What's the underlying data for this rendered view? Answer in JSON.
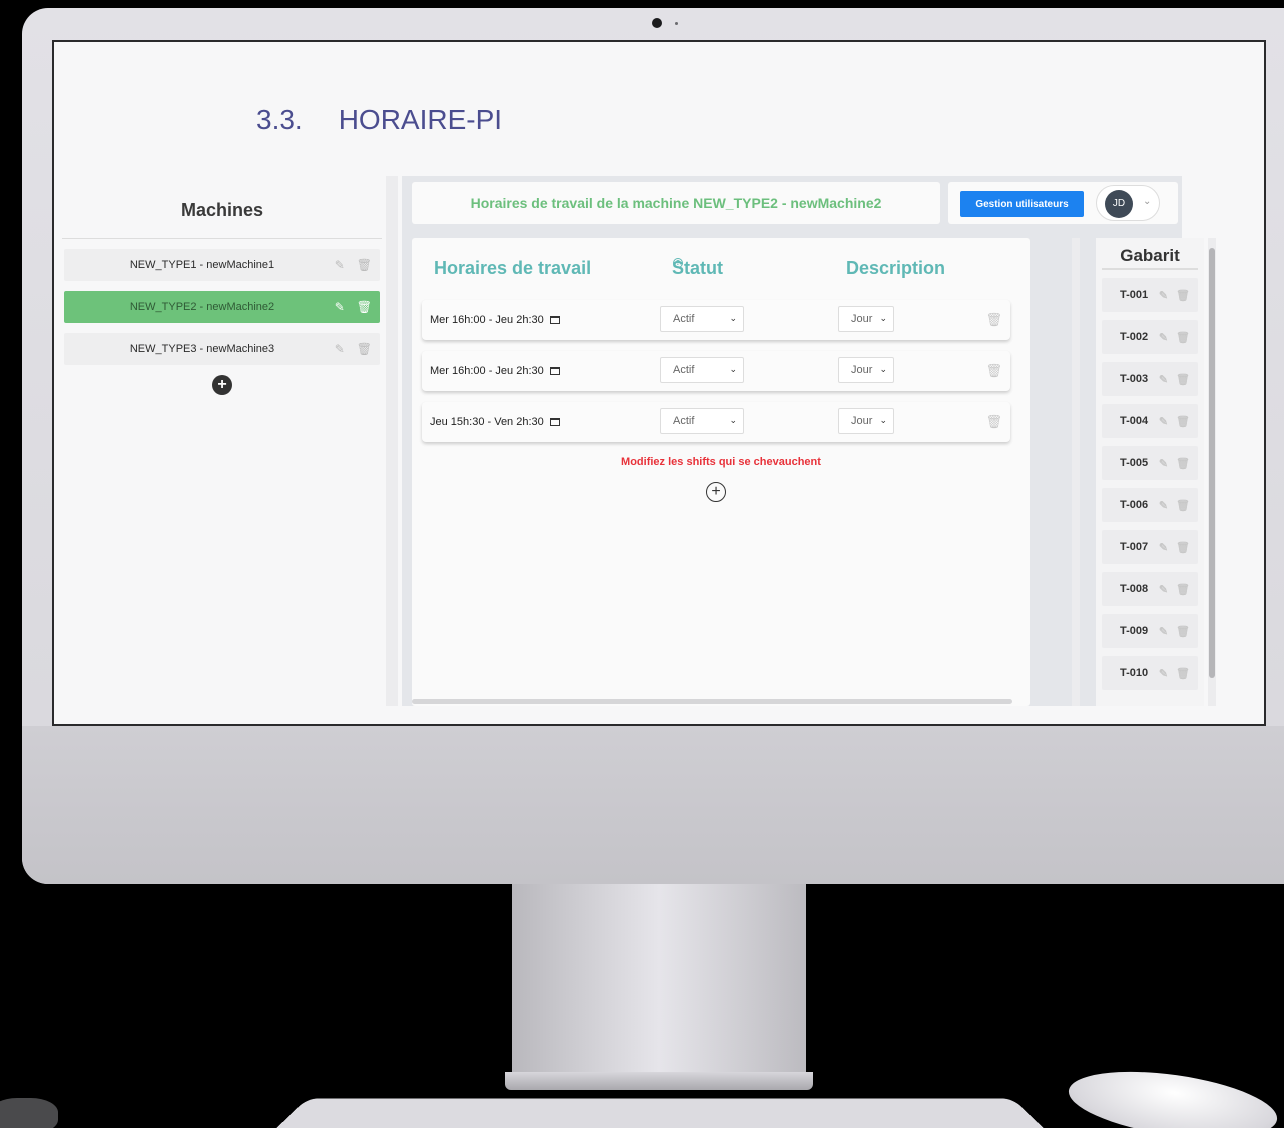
{
  "doc_heading": {
    "number": "3.3.",
    "title": "HORAIRE-PI"
  },
  "machines": {
    "title": "Machines",
    "items": [
      {
        "label": "NEW_TYPE1 - newMachine1",
        "active": false
      },
      {
        "label": "NEW_TYPE2 - newMachine2",
        "active": true
      },
      {
        "label": "NEW_TYPE3 - newMachine3",
        "active": false
      }
    ],
    "add_glyph": "+"
  },
  "header": {
    "title": "Horaires de travail de la machine NEW_TYPE2 - newMachine2",
    "users_button": "Gestion utilisateurs",
    "avatar_initials": "JD"
  },
  "schedule": {
    "columns": {
      "hours": "Horaires de travail",
      "status": "Statut",
      "status_help": "?",
      "description": "Description"
    },
    "rows": [
      {
        "time": "Mer 16h:00 - Jeu 2h:30",
        "status": "Actif",
        "description": "Jour"
      },
      {
        "time": "Mer 16h:00 - Jeu 2h:30",
        "status": "Actif",
        "description": "Jour"
      },
      {
        "time": "Jeu 15h:30 - Ven 2h:30",
        "status": "Actif",
        "description": "Jour"
      }
    ],
    "warning": "Modifiez les shifts qui se chevauchent",
    "add_glyph": "+"
  },
  "gabarit": {
    "title": "Gabarit",
    "items": [
      "T-001",
      "T-002",
      "T-003",
      "T-004",
      "T-005",
      "T-006",
      "T-007",
      "T-008",
      "T-009",
      "T-010"
    ]
  },
  "icons": {
    "edit": "edit-icon",
    "delete": "trash-icon",
    "calendar": "calendar-icon",
    "add": "plus-circle-icon",
    "chevron": "chevron-down-icon"
  },
  "colors": {
    "accent_green": "#6dc27a",
    "header_text": "#6cbf7d",
    "column_header": "#5fb8b5",
    "primary_button": "#1c82f0",
    "warning": "#e8323a",
    "doc_heading": "#4b4d8f"
  }
}
